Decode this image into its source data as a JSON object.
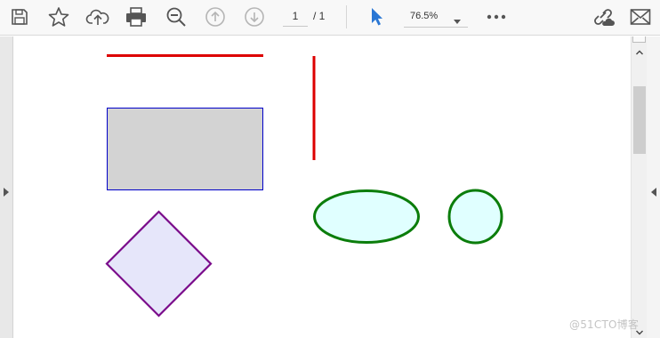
{
  "toolbar": {
    "icons": [
      "save-icon",
      "star-icon",
      "cloud-upload-icon",
      "print-icon",
      "zoom-out-icon",
      "previous-page-icon",
      "next-page-icon",
      "select-pointer-icon",
      "more-icon",
      "share-link-icon",
      "email-icon"
    ],
    "current_page": "1",
    "page_total": "/ 1",
    "zoom_value": "76.5%"
  },
  "colors": {
    "accent_blue": "#2a77d4",
    "line_red": "#dd0000",
    "rect_fill": "#d3d3d3",
    "rect_stroke": "#0000c8",
    "diamond_fill": "#e6e6fa",
    "diamond_stroke": "#7a0a8a",
    "ellipse_fill": "#e0ffff",
    "ellipse_stroke": "#0b7d0b"
  },
  "document": {
    "shapes": [
      "horizontal-line",
      "vertical-line",
      "rectangle",
      "diamond",
      "ellipse",
      "circle"
    ]
  },
  "watermark": "@51CTO博客"
}
